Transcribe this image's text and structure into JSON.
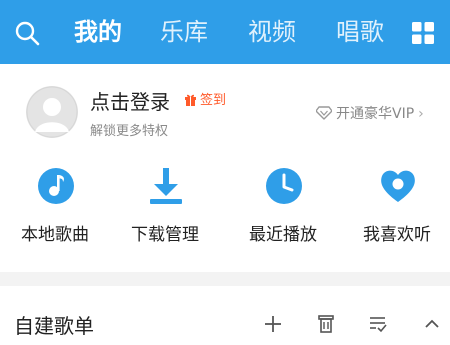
{
  "top_nav": {
    "tabs": [
      {
        "label": "我的",
        "active": true
      },
      {
        "label": "乐库",
        "active": false
      },
      {
        "label": "视频",
        "active": false
      },
      {
        "label": "唱歌",
        "active": false
      }
    ],
    "background_color": "#2f9ee8",
    "search_icon": "search-icon",
    "menu_icon": "grid-icon"
  },
  "profile": {
    "login_text": "点击登录",
    "checkin_label": "签到",
    "subtitle": "解锁更多特权",
    "vip_label": "开通豪华VIP",
    "accent_color": "#ff5a2a"
  },
  "quick_actions": [
    {
      "label": "本地歌曲",
      "icon": "music-note-icon"
    },
    {
      "label": "下载管理",
      "icon": "download-icon"
    },
    {
      "label": "最近播放",
      "icon": "clock-icon"
    },
    {
      "label": "我喜欢听",
      "icon": "heart-icon"
    }
  ],
  "playlist_section": {
    "title": "自建歌单",
    "actions": [
      "add-icon",
      "manage-icon",
      "sort-icon",
      "collapse-icon"
    ]
  },
  "icon_color": "#2f9ee8"
}
